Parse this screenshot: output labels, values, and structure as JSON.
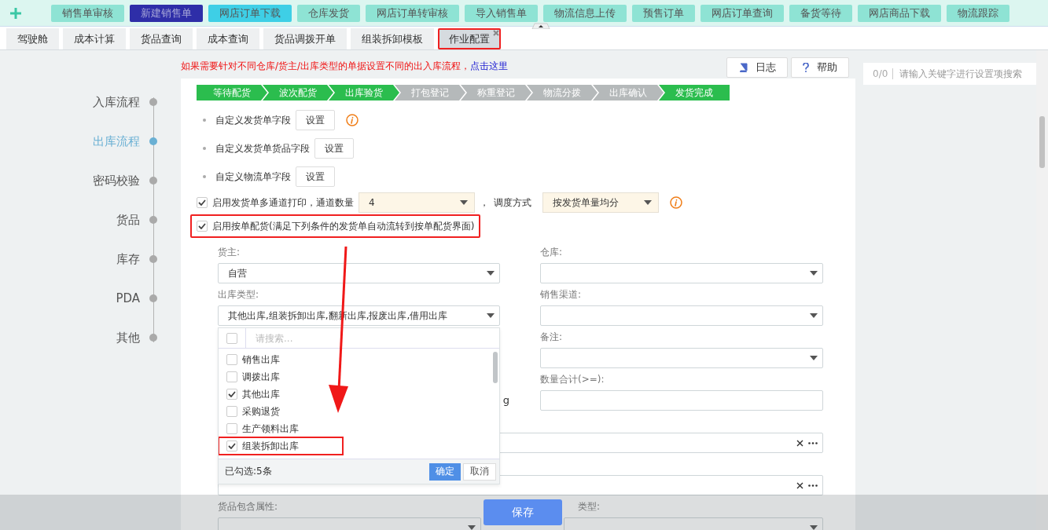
{
  "toolbar": {
    "buttons": [
      {
        "label": "销售单审核",
        "color": "#8ee3d4"
      },
      {
        "label": "新建销售单",
        "color": "#2e2ea8"
      },
      {
        "label": "网店订单下载",
        "color": "#3ecfe6"
      },
      {
        "label": "仓库发货",
        "color": "#8ee3d4"
      },
      {
        "label": "网店订单转审核",
        "color": "#8ee3d4"
      },
      {
        "label": "导入销售单",
        "color": "#8ee3d4"
      },
      {
        "label": "物流信息上传",
        "color": "#8ee3d4"
      },
      {
        "label": "预售订单",
        "color": "#8ee3d4"
      },
      {
        "label": "网店订单查询",
        "color": "#8ee3d4"
      },
      {
        "label": "备货等待",
        "color": "#8ee3d4"
      },
      {
        "label": "网店商品下载",
        "color": "#8ee3d4"
      },
      {
        "label": "物流跟踪",
        "color": "#8ee3d4"
      }
    ]
  },
  "tabs": [
    {
      "label": "驾驶舱",
      "selected": false,
      "highlighted": false
    },
    {
      "label": "成本计算",
      "selected": false,
      "highlighted": false
    },
    {
      "label": "货品查询",
      "selected": false,
      "highlighted": false
    },
    {
      "label": "成本查询",
      "selected": false,
      "highlighted": false
    },
    {
      "label": "货品调拨开单",
      "selected": false,
      "highlighted": false
    },
    {
      "label": "组装拆卸模板",
      "selected": false,
      "highlighted": false
    },
    {
      "label": "作业配置",
      "selected": true,
      "highlighted": true
    }
  ],
  "notice": {
    "text": "如果需要针对不同仓库/货主/出库类型的单据设置不同的出入库流程，",
    "link": "点击这里"
  },
  "header_buttons": [
    {
      "kind": "log",
      "label": "日志"
    },
    {
      "kind": "help",
      "label": "帮助"
    }
  ],
  "sidebar": {
    "items": [
      {
        "label": "入库流程",
        "selected": false
      },
      {
        "label": "出库流程",
        "selected": true
      },
      {
        "label": "密码校验",
        "selected": false
      },
      {
        "label": "货品",
        "selected": false
      },
      {
        "label": "库存",
        "selected": false
      },
      {
        "label": "PDA",
        "selected": false
      },
      {
        "label": "其他",
        "selected": false
      }
    ]
  },
  "search": {
    "count": "0/0",
    "placeholder": "请输入关键字进行设置项搜索"
  },
  "steps": [
    {
      "label": "等待配货",
      "done": true
    },
    {
      "label": "波次配货",
      "done": true
    },
    {
      "label": "出库验货",
      "done": true
    },
    {
      "label": "打包登记",
      "done": false
    },
    {
      "label": "称重登记",
      "done": false
    },
    {
      "label": "物流分拨",
      "done": false
    },
    {
      "label": "出库确认",
      "done": false
    },
    {
      "label": "发货完成",
      "done": true
    }
  ],
  "settings": [
    {
      "kind": "button",
      "label": "自定义发货单字段",
      "button": "设置",
      "info": true
    },
    {
      "kind": "button",
      "label": "自定义发货单货品字段",
      "button": "设置",
      "info": false
    },
    {
      "kind": "button",
      "label": "自定义物流单字段",
      "button": "设置",
      "info": false
    },
    {
      "kind": "channels",
      "checked": true,
      "label": "启用发货单多通道打印，通道数量",
      "count": "4",
      "separator": "，",
      "mode_label": "调度方式",
      "mode": "按发货单量均分",
      "info": true
    },
    {
      "kind": "checkbox",
      "checked": true,
      "label": "启用按单配货(满足下列条件的发货单自动流转到按单配货界面)",
      "highlighted": true
    }
  ],
  "form": {
    "fields": [
      {
        "kind": "select",
        "label": "货主:",
        "value": "自营"
      },
      {
        "kind": "select",
        "label": "仓库:"
      },
      {
        "kind": "select",
        "label": "出库类型:",
        "value": "其他出库,组装拆卸出库,翻新出库,报废出库,借用出库",
        "dropdown": true
      },
      {
        "kind": "select",
        "label": "销售渠道:"
      },
      {
        "kind": "covered"
      },
      {
        "kind": "select",
        "label": "备注:"
      },
      {
        "kind": "fragment",
        "text": "g"
      },
      {
        "kind": "input",
        "label": "数量合计(>=):"
      },
      {
        "kind": "picker"
      },
      {
        "kind": "picker"
      },
      {
        "kind": "select",
        "label": "货品包含属性:"
      },
      {
        "kind": "select",
        "label": "类型:"
      }
    ]
  },
  "dropdown": {
    "search_placeholder": "请搜索...",
    "all_checked": false,
    "options": [
      {
        "label": "销售出库",
        "checked": false,
        "highlighted": false
      },
      {
        "label": "调拨出库",
        "checked": false,
        "highlighted": false
      },
      {
        "label": "其他出库",
        "checked": true,
        "highlighted": false
      },
      {
        "label": "采购退货",
        "checked": false,
        "highlighted": false
      },
      {
        "label": "生产领料出库",
        "checked": false,
        "highlighted": false
      },
      {
        "label": "组装拆卸出库",
        "checked": true,
        "highlighted": true
      }
    ],
    "summary": "已勾选:5条",
    "confirm": "确定",
    "cancel": "取消"
  },
  "save_button": "保存"
}
